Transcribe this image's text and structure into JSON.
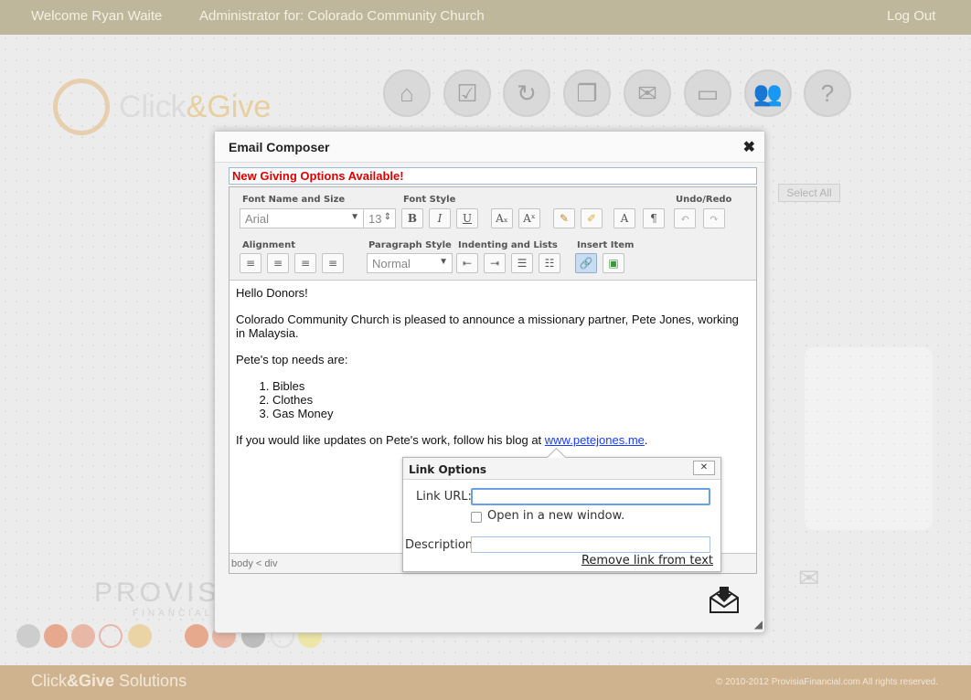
{
  "topbar": {
    "welcome": "Welcome Ryan Waite",
    "admin": "Administrator for: Colorado Community Church",
    "logout": "Log Out"
  },
  "logo": {
    "text_a": "Click",
    "text_b": "&Give"
  },
  "nav_icons": [
    "home-icon",
    "checklist-icon",
    "refresh-icon",
    "copy-icon",
    "mail-icon",
    "folder-network-icon",
    "users-icon",
    "help-icon"
  ],
  "select_all": "Select All",
  "provisia": {
    "name": "PROVISIA",
    "sub": "FINANCIAL"
  },
  "footer": {
    "brand_a": "Click",
    "brand_b": "&Give",
    "brand_c": " Solutions",
    "copyright": "© 2010-2012 ProvisiaFinancial.com  All rights reserved."
  },
  "dialog": {
    "title": "Email Composer",
    "close": "✖",
    "subject": "New Giving Options Available!",
    "toolbar": {
      "font_name_label": "Font Name and Size",
      "font_name": "Arial",
      "font_size": "13",
      "font_style_label": "Font Style",
      "undo_redo_label": "Undo/Redo",
      "alignment_label": "Alignment",
      "paragraph_label": "Paragraph Style",
      "paragraph_value": "Normal",
      "indent_label": "Indenting and Lists",
      "insert_label": "Insert Item"
    },
    "body": {
      "greeting": "Hello Donors!",
      "para1": "Colorado Community Church is pleased to announce a missionary partner, Pete Jones, working in Malaysia.",
      "para2": "Pete's top needs are:",
      "needs": [
        "Bibles",
        "Clothes",
        "Gas Money"
      ],
      "para3_pre": "If you would like updates on Pete's work, follow his blog at ",
      "link": "www.petejones.me",
      "para3_post": "."
    },
    "status_path": "body < div"
  },
  "link_options": {
    "title": "Link Options",
    "close": "✕",
    "url_label": "Link URL:",
    "url_value": "",
    "new_window_label": "Open in a new window.",
    "desc_label": "Description:",
    "desc_value": "",
    "remove_label": "Remove link from text"
  }
}
